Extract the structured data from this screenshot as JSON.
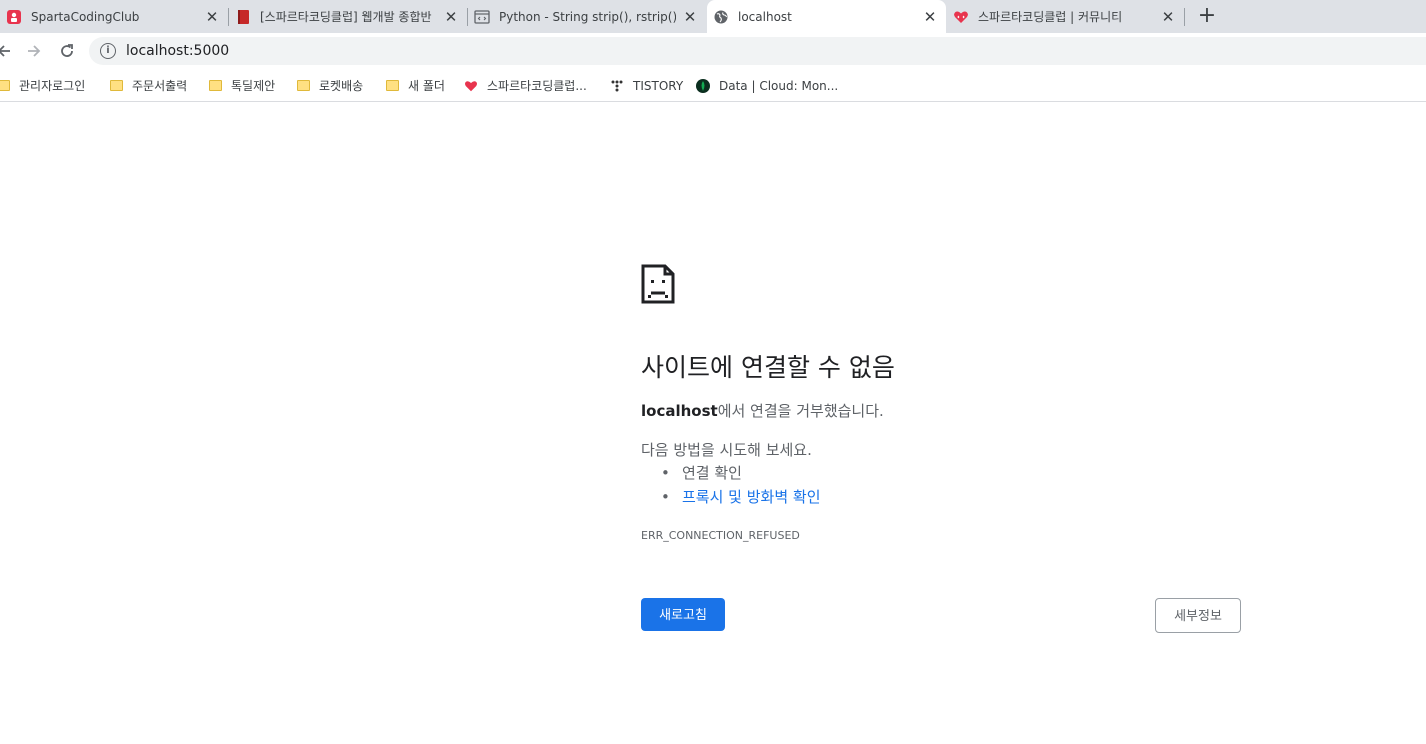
{
  "tabs": [
    {
      "title": "SpartaCodingClub",
      "icon": "sparta-logo-icon",
      "active": false
    },
    {
      "title": "[스파르타코딩클럽] 웹개발 종합반",
      "icon": "book-icon",
      "active": false
    },
    {
      "title": "Python - String strip(), rstrip(), lstrip()",
      "icon": "code-icon",
      "active": false
    },
    {
      "title": "localhost",
      "icon": "globe-icon",
      "active": true
    },
    {
      "title": "스파르타코딩클럽 | 커뮤니티",
      "icon": "sparta-heart-icon",
      "active": false
    }
  ],
  "toolbar": {
    "url": "localhost:5000"
  },
  "bookmarks": [
    {
      "label": "관리자로그인",
      "icon": "folder-icon"
    },
    {
      "label": "주문서출력",
      "icon": "folder-icon"
    },
    {
      "label": "톡딜제안",
      "icon": "folder-icon"
    },
    {
      "label": "로켓배송",
      "icon": "folder-icon"
    },
    {
      "label": "새 폴더",
      "icon": "folder-icon"
    },
    {
      "label": "스파르타코딩클럽...",
      "icon": "sparta-heart-icon"
    },
    {
      "label": "TISTORY",
      "icon": "tistory-icon"
    },
    {
      "label": "Data | Cloud: Mon...",
      "icon": "mongodb-leaf-icon"
    }
  ],
  "error": {
    "title": "사이트에 연결할 수 없음",
    "host": "localhost",
    "desc_suffix": "에서 연결을 거부했습니다.",
    "suggest": "다음 방법을 시도해 보세요.",
    "items": [
      "연결 확인",
      "프록시 및 방화벽 확인"
    ],
    "code": "ERR_CONNECTION_REFUSED",
    "reload_label": "새로고침",
    "details_label": "세부정보"
  },
  "colors": {
    "accent": "#1a73e8",
    "tabstrip": "#dee1e6",
    "omnibox": "#f1f3f4"
  }
}
